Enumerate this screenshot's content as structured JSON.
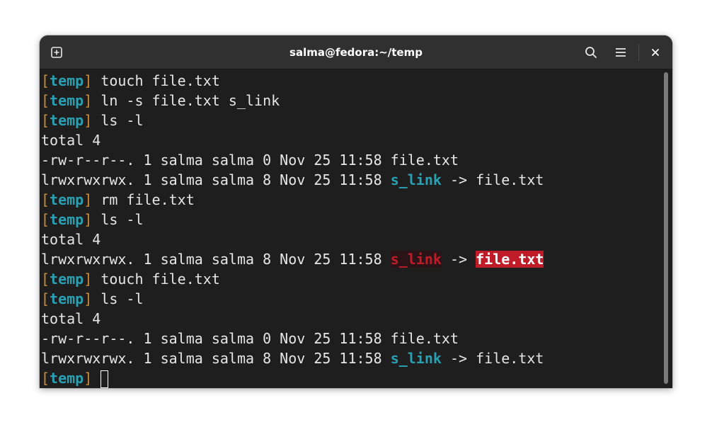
{
  "window": {
    "title": "salma@fedora:~/temp"
  },
  "header_icons": {
    "new_tab": "new-tab-icon",
    "search": "search-icon",
    "menu": "hamburger-menu-icon",
    "close": "close-icon",
    "close_glyph": "×"
  },
  "prompt": {
    "open": "[",
    "dir": "temp",
    "close": "]"
  },
  "colors": {
    "background": "#1e1e1e",
    "prompt_bracket": "#c88d3c",
    "directory": "#2aa1b3",
    "broken_link": "#c01c28"
  },
  "terminal": {
    "cmd1": "touch file.txt",
    "cmd2": "ln -s file.txt s_link",
    "cmd3": "ls -l",
    "out1_total": "total 4",
    "out1_file_line": "-rw-r--r--. 1 salma salma 0 Nov 25 11:58 file.txt",
    "out1_link_prefix": "lrwxrwxrwx. 1 salma salma 8 Nov 25 11:58 ",
    "out1_link_name": "s_link",
    "out1_arrow": " -> ",
    "out1_link_target": "file.txt",
    "cmd4": "rm file.txt",
    "cmd5": "ls -l",
    "out2_total": "total 4",
    "out2_link_prefix": "lrwxrwxrwx. 1 salma salma 8 Nov 25 11:58 ",
    "out2_link_name": "s_link",
    "out2_arrow": " -> ",
    "out2_link_target": "file.txt",
    "cmd6": "touch file.txt",
    "cmd7": "ls -l",
    "out3_total": "total 4",
    "out3_file_line": "-rw-r--r--. 1 salma salma 0 Nov 25 11:58 file.txt",
    "out3_link_prefix": "lrwxrwxrwx. 1 salma salma 8 Nov 25 11:58 ",
    "out3_link_name": "s_link",
    "out3_arrow": " -> ",
    "out3_link_target": "file.txt"
  }
}
